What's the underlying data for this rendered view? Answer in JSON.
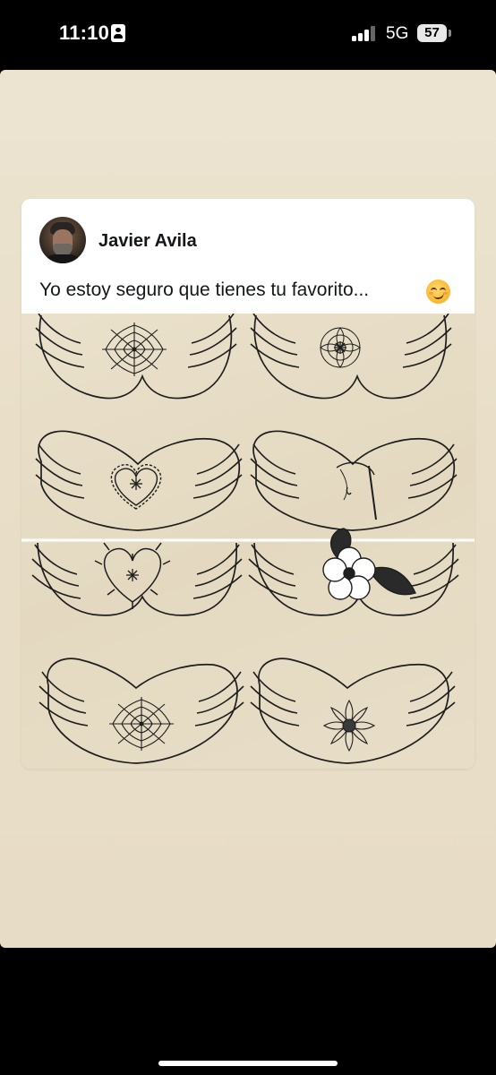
{
  "status_bar": {
    "time": "11:10",
    "network": "5G",
    "battery": "57",
    "icons": [
      "id-card-icon",
      "signal-icon",
      "battery-icon"
    ]
  },
  "post": {
    "author": "Javier Avila",
    "text": "Yo estoy seguro que tienes tu favorito...",
    "emoji": "smirking-face-emoji",
    "image": {
      "description_icon": "tattoo-designs-illustration",
      "designs": [
        "spider-web",
        "mandala-flower",
        "barbed-heart",
        "scythe",
        "thorn-heart",
        "traditional-flower",
        "spider-web",
        "lotus-mandala"
      ]
    }
  },
  "colors": {
    "background": "#000000",
    "story_background": "#e9dfc9",
    "card": "#ffffff",
    "text": "#14171a",
    "line_art": "#1e1e1e"
  }
}
